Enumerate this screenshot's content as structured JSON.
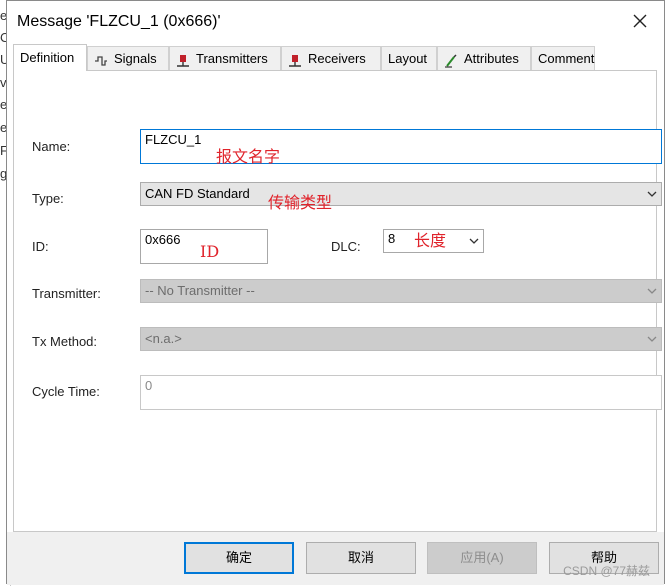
{
  "window": {
    "title": "Message 'FLZCU_1 (0x666)'"
  },
  "tabs": [
    {
      "label": "Definition",
      "icon": ""
    },
    {
      "label": "Signals",
      "icon": "signals-icon"
    },
    {
      "label": "Transmitters",
      "icon": "transmitter-icon"
    },
    {
      "label": "Receivers",
      "icon": "receiver-icon"
    },
    {
      "label": "Layout",
      "icon": ""
    },
    {
      "label": "Attributes",
      "icon": "attributes-icon"
    },
    {
      "label": "Comment",
      "icon": ""
    }
  ],
  "form": {
    "name_label": "Name:",
    "name_value": "FLZCU_1",
    "type_label": "Type:",
    "type_value": "CAN FD Standard",
    "id_label": "ID:",
    "id_value": "0x666",
    "dlc_label": "DLC:",
    "dlc_value": "8",
    "transmitter_label": "Transmitter:",
    "transmitter_value": "-- No Transmitter --",
    "txmethod_label": "Tx Method:",
    "txmethod_value": "<n.a.>",
    "cycle_label": "Cycle Time:",
    "cycle_value": "0"
  },
  "annotations": {
    "name": "报文名字",
    "type": "传输类型",
    "id": "ID",
    "dlc": "长度"
  },
  "buttons": {
    "ok": "确定",
    "cancel": "取消",
    "apply": "应用(A)",
    "help": "帮助"
  },
  "background_glyphs": [
    "e",
    "C",
    "U",
    "v",
    "e",
    "e",
    "F",
    "g"
  ],
  "watermark": "CSDN @77赫兹",
  "colors": {
    "accent": "#0078d7",
    "annotation": "#e0232b"
  }
}
